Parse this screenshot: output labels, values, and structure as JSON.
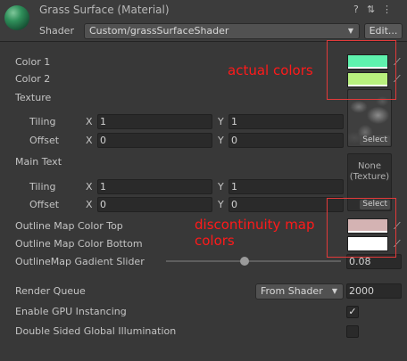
{
  "header": {
    "title": "Grass Surface (Material)",
    "shader_label": "Shader",
    "shader_value": "Custom/grassSurfaceShader",
    "edit_button": "Edit...",
    "help_icon": "help-icon",
    "settings_icon": "sliders-icon",
    "menu_icon": "kebab-menu-icon"
  },
  "props": {
    "color1_label": "Color 1",
    "color2_label": "Color 2",
    "texture_label": "Texture",
    "tiling_label": "Tiling",
    "offset_label": "Offset",
    "x": "X",
    "y": "Y",
    "tex_tiling_x": "1",
    "tex_tiling_y": "1",
    "tex_offset_x": "0",
    "tex_offset_y": "0",
    "maintext_label": "Main Text",
    "main_tiling_x": "1",
    "main_tiling_y": "1",
    "main_offset_x": "0",
    "main_offset_y": "0",
    "select_label": "Select",
    "none_texture_line1": "None",
    "none_texture_line2": "(Texture)",
    "outline_top_label": "Outline Map Color Top",
    "outline_bottom_label": "Outline Map Color Bottom",
    "gradient_slider_label": "OutlineMap Gadient Slider",
    "gradient_slider_value": "0.08",
    "gradient_slider_fraction": 0.45
  },
  "colors": {
    "color1": "#5ff2ae",
    "color2": "#b8f07e",
    "outline_top": "#d4b3b3",
    "outline_bottom": "#ffffff",
    "annotation": "#ff1a1a"
  },
  "advanced": {
    "render_queue_label": "Render Queue",
    "render_queue_mode": "From Shader",
    "render_queue_value": "2000",
    "gpu_instancing_label": "Enable GPU Instancing",
    "gpu_instancing_checked": true,
    "double_sided_label": "Double Sided Global Illumination",
    "double_sided_checked": false
  },
  "annotations": {
    "actual_colors": "actual colors",
    "discontinuity_line1": "discontinuity map",
    "discontinuity_line2": "colors"
  }
}
